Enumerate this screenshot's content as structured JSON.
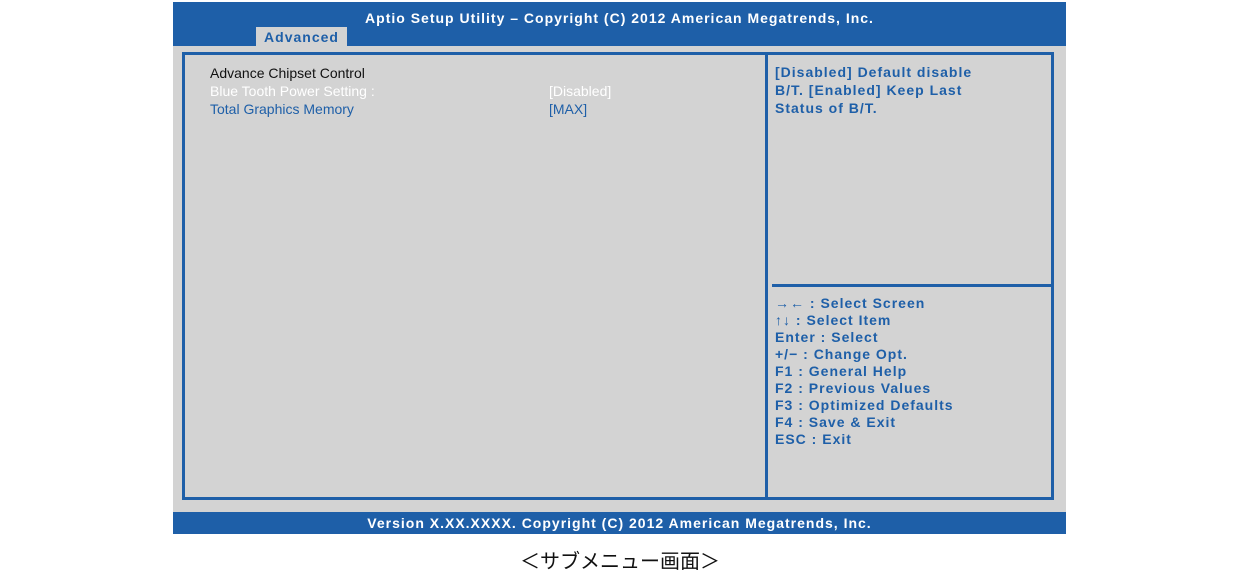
{
  "header": {
    "title": "Aptio Setup Utility – Copyright (C) 2012 American Megatrends, Inc.",
    "active_tab": "Advanced"
  },
  "menu": {
    "heading": "Advance Chipset Control",
    "rows": [
      {
        "label": "Blue Tooth Power Setting :",
        "value": "[Disabled]",
        "state": "selected"
      },
      {
        "label": "Total Graphics Memory",
        "value": "[MAX]",
        "state": "normal"
      }
    ]
  },
  "help": {
    "lines": [
      "[Disabled] Default disable",
      "B/T. [Enabled] Keep Last",
      "Status of B/T."
    ]
  },
  "keys": [
    {
      "key": "→← :",
      "desc": "Select Screen"
    },
    {
      "key": "↑↓ :",
      "desc": "Select Item"
    },
    {
      "key": "Enter :",
      "desc": "Select"
    },
    {
      "key": "+/− :",
      "desc": "Change Opt."
    },
    {
      "key": "F1 :",
      "desc": "General Help"
    },
    {
      "key": "F2 :",
      "desc": "Previous Values"
    },
    {
      "key": "F3 :",
      "desc": "Optimized Defaults"
    },
    {
      "key": "F4 :",
      "desc": "Save & Exit"
    },
    {
      "key": "ESC :",
      "desc": "Exit"
    }
  ],
  "footer": {
    "version": "Version X.XX.XXXX. Copyright (C) 2012 American Megatrends, Inc."
  },
  "caption": "＜サブメニュー画面＞",
  "colors": {
    "accent_blue": "#1e5fa8",
    "panel_gray": "#d3d3d3",
    "text_white": "#ffffff"
  }
}
